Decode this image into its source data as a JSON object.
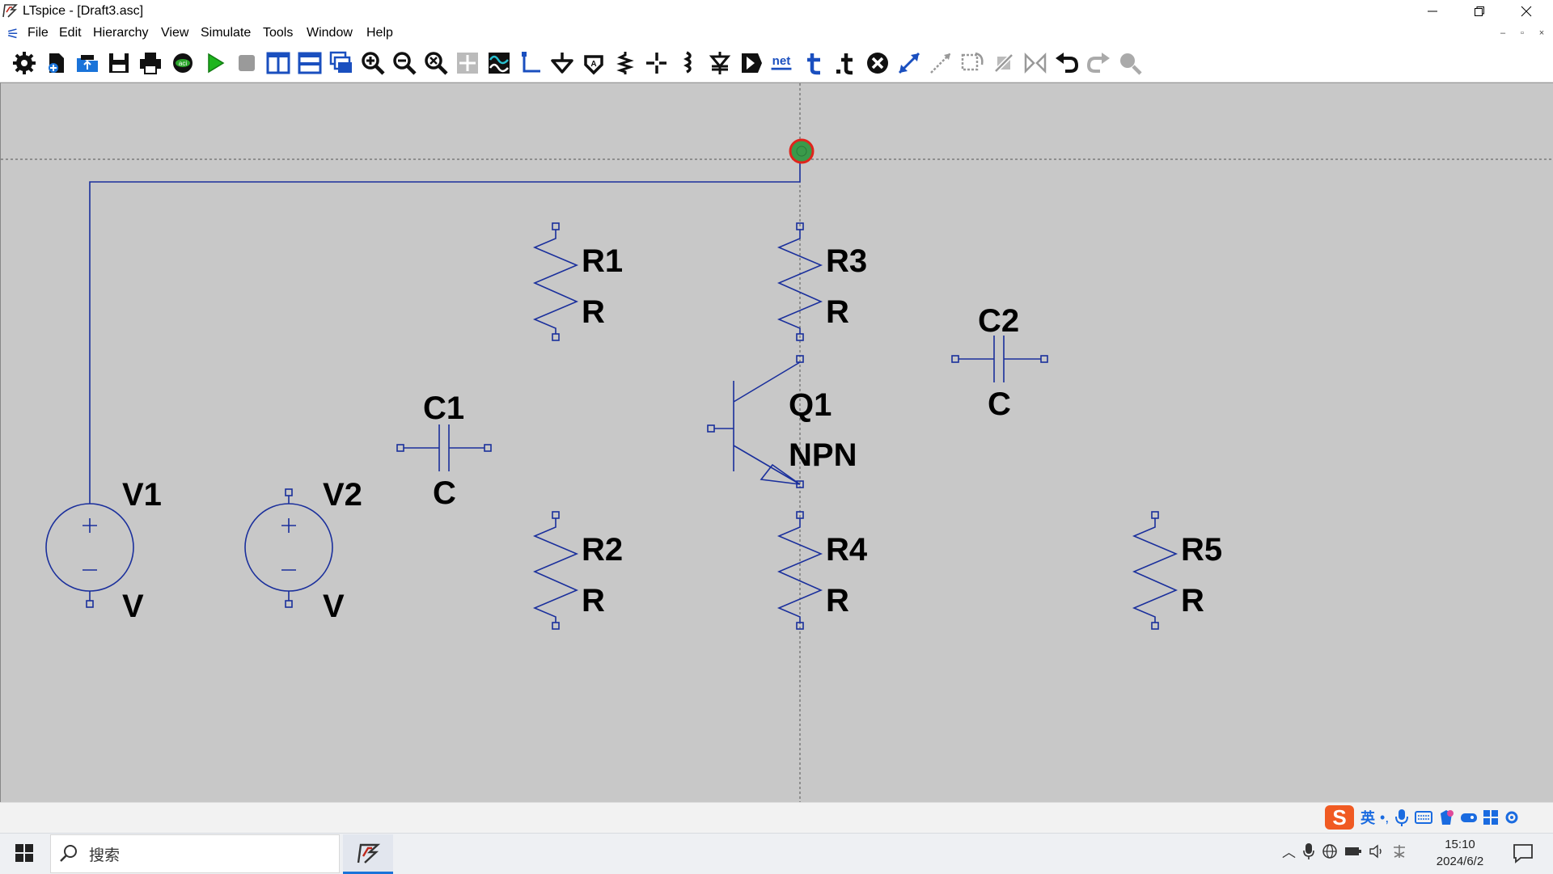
{
  "window": {
    "title": "LTspice - [Draft3.asc]"
  },
  "menu": [
    "File",
    "Edit",
    "Hierarchy",
    "View",
    "Simulate",
    "Tools",
    "Window",
    "Help"
  ],
  "toolbar": {
    "net_label": "net",
    "icons": [
      "gear-icon",
      "new-schematic-icon",
      "open-icon",
      "save-icon",
      "print-icon",
      "spice-directive-icon",
      "run-icon",
      "halt-icon",
      "tile-vertical-icon",
      "tile-horizontal-icon",
      "cascade-icon",
      "zoom-in-icon",
      "zoom-out-icon",
      "zoom-fit-icon",
      "pan-icon",
      "waveform-icon",
      "wire-icon",
      "ground-icon",
      "label-net-icon",
      "resistor-icon",
      "capacitor-icon",
      "inductor-icon",
      "diode-icon",
      "component-icon",
      "net-name-icon",
      "text-icon",
      "spice-directive-t-icon",
      "delete-icon",
      "move-icon",
      "drag-icon",
      "rotate-icon",
      "mirror-icon",
      "duplicate-icon",
      "undo-icon",
      "redo-icon",
      "find-icon"
    ]
  },
  "schematic": {
    "components": [
      {
        "ref": "R1",
        "value": "R"
      },
      {
        "ref": "R2",
        "value": "R"
      },
      {
        "ref": "R3",
        "value": "R"
      },
      {
        "ref": "R4",
        "value": "R"
      },
      {
        "ref": "R5",
        "value": "R"
      },
      {
        "ref": "C1",
        "value": "C"
      },
      {
        "ref": "C2",
        "value": "C"
      },
      {
        "ref": "Q1",
        "value": "NPN"
      },
      {
        "ref": "V1",
        "value": "V"
      },
      {
        "ref": "V2",
        "value": "V"
      }
    ],
    "colors": {
      "canvas": "#c8c8c8",
      "wire": "#1a2f9c",
      "component": "#1a2f9c",
      "cursor_fill": "#3a9a4a",
      "cursor_ring": "#e0241c"
    }
  },
  "ime": {
    "lang": "英"
  },
  "taskbar": {
    "search_placeholder": "搜索",
    "time": "15:10",
    "date": "2024/6/2"
  }
}
